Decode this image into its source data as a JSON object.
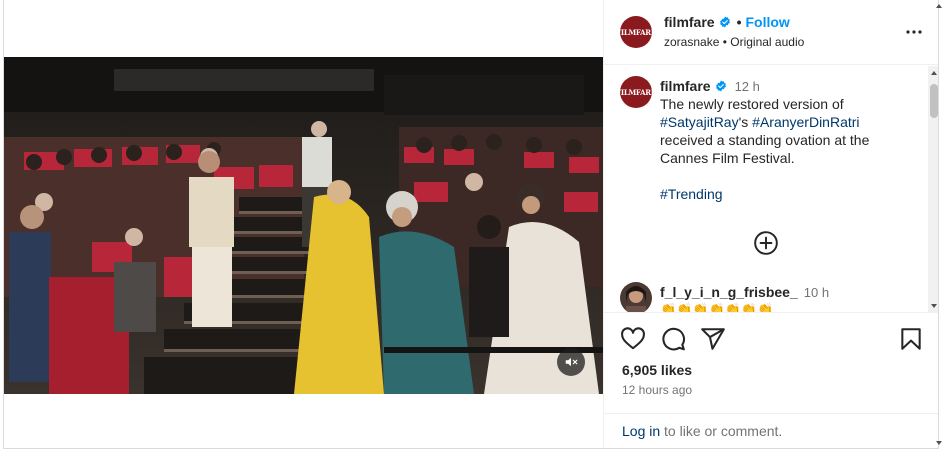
{
  "brand": {
    "avatar_text": "FILMFARE",
    "color": "#8b1a1f"
  },
  "header": {
    "username": "filmfare",
    "separator": "•",
    "follow_label": "Follow",
    "audio_creator": "zorasnake",
    "audio_sep": " • ",
    "audio_label": "Original audio"
  },
  "caption": {
    "username": "filmfare",
    "time": "12 h",
    "text_part1": "The newly restored version of ",
    "tag1": "#SatyajitRay",
    "text_part2": "'s ",
    "tag2": "#AranyerDinRatri",
    "text_part3": " received a standing ovation at the Cannes Film Festival.",
    "tag3": "#Trending"
  },
  "comment": {
    "username": "f_l_y_i_n_g_frisbee_",
    "time": "10 h",
    "text": "👏👏👏👏👏👏👏"
  },
  "engagement": {
    "likes": "6,905 likes",
    "posted": "12 hours ago"
  },
  "footer": {
    "login_label": "Log in",
    "login_suffix": " to like or comment."
  },
  "icons": {
    "more": "more-options-icon",
    "add_comment": "plus-circle-icon",
    "like": "heart-icon",
    "comment": "comment-icon",
    "share": "share-icon",
    "save": "bookmark-icon",
    "mute": "muted-speaker-icon",
    "verified": "verified-badge-icon"
  },
  "colors": {
    "link": "#0095f6",
    "tag": "#00376b",
    "muted": "#737373"
  }
}
